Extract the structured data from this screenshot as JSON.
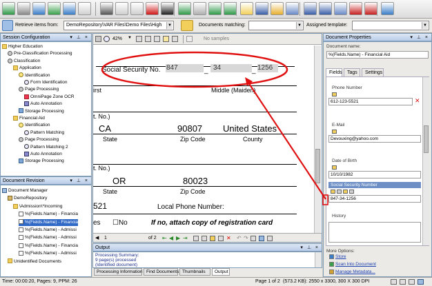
{
  "toolbar": {
    "icons": [
      "run-icon",
      "stop-icon",
      "scan-icon",
      "import-icon",
      "export-icon",
      "split-icon",
      "scissors-icon",
      "copy-icon",
      "paste-icon",
      "delete-icon",
      "rename-icon",
      "undo-icon",
      "redo-icon",
      "check-icon",
      "refresh-icon",
      "folder-icon",
      "save-icon",
      "settings-icon",
      "view-icon",
      "detail-icon",
      "list-icon",
      "thumb-icon",
      "stop-red-icon",
      "power-icon",
      "help-icon"
    ]
  },
  "subbar": {
    "retrieve_label": "Retrieve items from:",
    "retrieve_value": "DemoRepository\\VAR Files\\Demo Files\\High",
    "docs_matching_label": "Documents matching:",
    "assigned_template_label": "Assigned template:"
  },
  "session_config": {
    "title": "Session Configuration",
    "controls": "▾ ⊥ ×",
    "items": [
      {
        "label": "Higher Education",
        "indent": 0,
        "icon": "folder"
      },
      {
        "label": "Pre-Classification Processing",
        "indent": 1,
        "icon": "gear"
      },
      {
        "label": "Classification",
        "indent": 1,
        "icon": "gear"
      },
      {
        "label": "Application",
        "indent": 2,
        "icon": "folder"
      },
      {
        "label": "Identification",
        "indent": 3,
        "icon": "eye"
      },
      {
        "label": "Form Identification",
        "indent": 4,
        "icon": "magnifier"
      },
      {
        "label": "Page Processing",
        "indent": 3,
        "icon": "gear"
      },
      {
        "label": "OmniPage Zone OCR",
        "indent": 4,
        "icon": "ocr"
      },
      {
        "label": "Auto Annotation",
        "indent": 4,
        "icon": "pen"
      },
      {
        "label": "Storage Processing",
        "indent": 3,
        "icon": "store"
      },
      {
        "label": "Financial Aid",
        "indent": 2,
        "icon": "folder"
      },
      {
        "label": "Identification",
        "indent": 3,
        "icon": "eye"
      },
      {
        "label": "Pattern Matching",
        "indent": 4,
        "icon": "magnifier"
      },
      {
        "label": "Page Processing",
        "indent": 3,
        "icon": "gear"
      },
      {
        "label": "Pattern Matching 2",
        "indent": 4,
        "icon": "magnifier"
      },
      {
        "label": "Auto Annotation",
        "indent": 4,
        "icon": "pen"
      },
      {
        "label": "Storage Processing",
        "indent": 3,
        "icon": "store"
      }
    ]
  },
  "doc_revision": {
    "title": "Document Revision",
    "controls": "▾ ⊥ ×",
    "items": [
      {
        "label": "Document Manager",
        "indent": 0,
        "icon": "mgr"
      },
      {
        "label": "DemoRepository",
        "indent": 1,
        "icon": "repo"
      },
      {
        "label": "\\Admission\\*Incoming",
        "indent": 2,
        "icon": "folder"
      },
      {
        "label": "%(Fields.Name) - Financia",
        "indent": 3,
        "icon": "doc"
      },
      {
        "label": "%(Fields.Name) - Financia",
        "indent": 3,
        "icon": "doc",
        "selected": true
      },
      {
        "label": "%(Fields.Name) - Admissi",
        "indent": 3,
        "icon": "doc"
      },
      {
        "label": "%(Fields.Name) - Admissi",
        "indent": 3,
        "icon": "doc"
      },
      {
        "label": "%(Fields.Name) - Financia",
        "indent": 3,
        "icon": "doc"
      },
      {
        "label": "%(Fields.Name) - Admissi",
        "indent": 3,
        "icon": "doc"
      },
      {
        "label": "Unidentified Documents",
        "indent": 1,
        "icon": "folder"
      }
    ]
  },
  "viewer": {
    "zoom": "42%",
    "no_samples": "No samples",
    "ssn_label": "Social Security No.",
    "ssn_1": "847",
    "ssn_2": "34",
    "ssn_3": "1256",
    "sep": "_",
    "first_frag": "irst",
    "middle": "Middle (Maiden)",
    "no_frag_1": "t. No.)",
    "state_1": "CA",
    "zip_1": "90807",
    "country_1": "United States",
    "state_label": "State",
    "zip_label": "Zip Code",
    "county_label": "County",
    "no_frag_2": "t. No.)",
    "state_2": "OR",
    "zip_2": "80023",
    "state_label_2": "State",
    "zip_label_2": "Zip Code",
    "phone_frag": "521",
    "local_phone": "Local Phone Number:",
    "yes_frag": "es",
    "no_box": "☐No",
    "attach_text": "If no, attach copy of registration card",
    "page_current": "1",
    "page_of": "of 2"
  },
  "output": {
    "title": "Output",
    "controls": "▾ ⊥ ×",
    "lines": [
      "Processing Summary:",
      "9 page(s) processed",
      "(Identified document)"
    ],
    "tabs": [
      "Processing Information",
      "Find Documents",
      "Thumbnails",
      "Output"
    ],
    "active_tab": "Output"
  },
  "doc_props": {
    "title": "Document Properties",
    "controls": "▾ ⊥ ×",
    "name_label": "Document name:",
    "name_value": "%(Fields.Name) - Financial Aid",
    "tabs": [
      "Fields",
      "Tags",
      "Settings"
    ],
    "active_tab": "Fields",
    "fields": [
      {
        "label": "Phone Number",
        "value": "612-123-5521"
      },
      {
        "label": "E-Mail",
        "value": "Devouxing@yahoo.com"
      },
      {
        "label": "Date of Birth",
        "value": "10/10/1982"
      },
      {
        "label": "Social Security Number",
        "value": "847-34-1256",
        "highlight": true
      },
      {
        "label": "History",
        "value": ""
      }
    ],
    "more_options_label": "More Options:",
    "options": [
      "Store",
      "Scan Into Document",
      "Manage Metadata..."
    ]
  },
  "status": {
    "left": "Time: 00:00:20, Pages: 9, PPM: 26",
    "page": "Page 1 of 2",
    "image_info": "(573.2 KB): 2550 x 3300, 300 X 300 DPI"
  },
  "colors": {
    "annotation_red": "#e01010",
    "selection_blue": "#3169c6",
    "panel_header": "#b9cce8"
  }
}
